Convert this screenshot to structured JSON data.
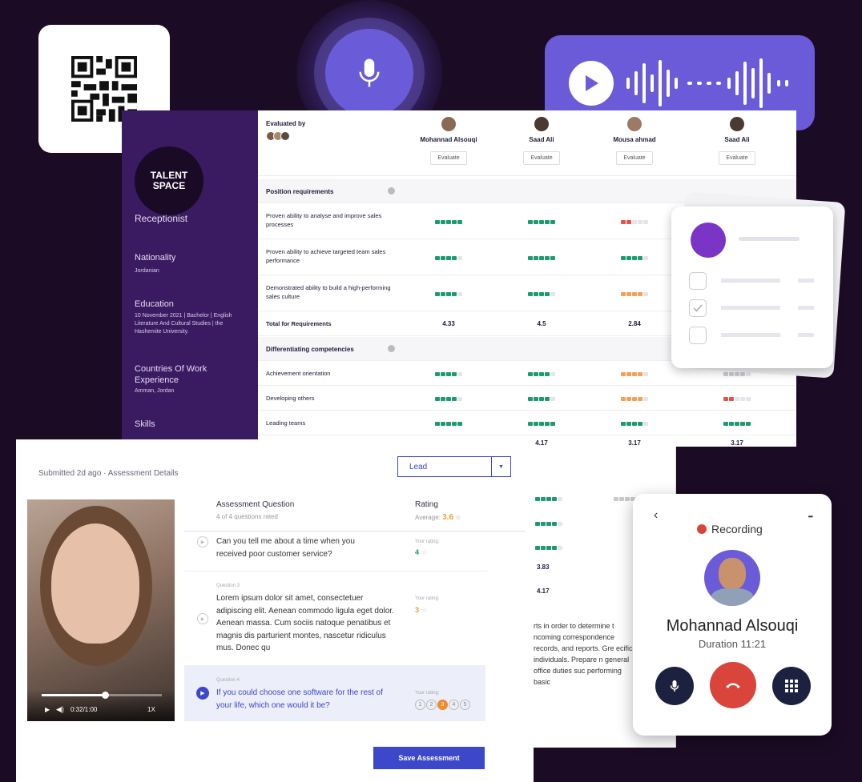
{
  "dashboard": {
    "logo": "TALENT SPACE",
    "position": "Receptionist",
    "nationality_label": "Nationality",
    "nationality_value": "Jordanian",
    "education_label": "Education",
    "education_value": "10 November 2021 | Bachelor | English Literature And Cultural Studies | the Hashemite University.",
    "countries_label": "Countries Of Work Experience",
    "countries_value": "Amman, Jordan",
    "skills_label": "Skills",
    "evaluated_by": "Evaluated by",
    "evaluate_label": "Evaluate",
    "candidates": [
      "Mohannad Alsouqi",
      "Saad Ali",
      "Mousa ahmad",
      "Saad Ali"
    ],
    "sections": {
      "position_requirements": "Position requirements",
      "differentiating": "Differentiating competencies"
    },
    "rows": [
      {
        "label": "Proven ability to analyse and improve sales processes"
      },
      {
        "label": "Proven ability to achieve targeted team sales performance"
      },
      {
        "label": "Demonstrated ability to build a high-performing sales culture"
      },
      {
        "label": "Total for Requirements",
        "values": [
          "4.33",
          "4.5",
          "2.84",
          ""
        ]
      },
      {
        "label": "Achievement orientation"
      },
      {
        "label": "Developing others"
      },
      {
        "label": "Leading teams"
      }
    ],
    "totals_row": [
      "4.17",
      "3.17",
      "3.17"
    ],
    "lower_values": [
      "3.83",
      "4.17"
    ],
    "colors": {
      "green": "#1f9a6e",
      "orange": "#f0a25a",
      "red": "#e0544b",
      "grey": "#c9c9cf"
    }
  },
  "assessment": {
    "submitted": "Submitted 2d ago · Assessment Details",
    "dropdown": "Lead",
    "col_question": "Assessment Question",
    "col_question_sub": "4 of 4 questions rated",
    "col_rating": "Rating",
    "col_rating_avg_label": "Average:",
    "col_rating_avg": "3.6",
    "questions": [
      {
        "number": "",
        "text": "Can you tell me about a time when you received poor customer service?",
        "rating_label": "Your rating:",
        "rating": "4"
      },
      {
        "number": "Question 3",
        "text": "Lorem ipsum dolor sit amet, consectetuer adipiscing elit. Aenean commodo ligula eget dolor. Aenean massa. Cum sociis natoque penatibus et magnis dis parturient montes, nascetur ridiculus mus. Donec qu",
        "rating_label": "Your rating:",
        "rating": "3"
      },
      {
        "number": "Question 4",
        "text": "If you could choose one software for the rest of your life, which one would it be?",
        "rating_label": "Your rating:",
        "rating_options": [
          "1",
          "2",
          "3",
          "4",
          "5"
        ]
      }
    ],
    "video_time": "0:32/1:00",
    "video_speed": "1X",
    "video_progress": 0.53,
    "save_button": "Save Assessment"
  },
  "side_text": "rts in order to determine t ncoming correspondence records, and reports. Gre ecific individuals. Prepare n general office duties suc performing basic",
  "call": {
    "status": "Recording",
    "name": "Mohannad Alsouqi",
    "duration": "Duration 11:21",
    "back": "‹",
    "more": "•••"
  }
}
